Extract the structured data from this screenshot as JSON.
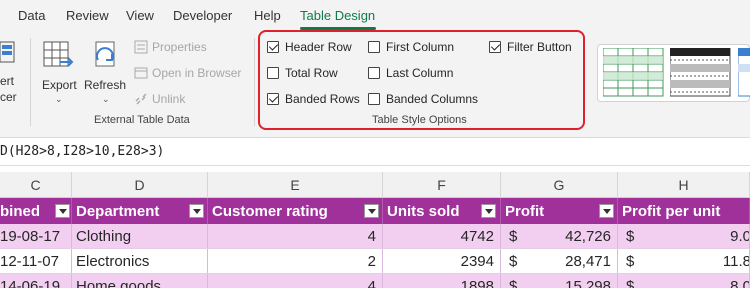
{
  "tabs": [
    "Data",
    "Review",
    "View",
    "Developer",
    "Help",
    "Table Design"
  ],
  "active_tab": "Table Design",
  "ribbon": {
    "tools": {
      "insert_slicer_line1": "ert",
      "insert_slicer_line2": "cer"
    },
    "external": {
      "export_label": "Export",
      "refresh_label": "Refresh",
      "properties_label": "Properties",
      "open_in_browser_label": "Open in Browser",
      "unlink_label": "Unlink",
      "group_label": "External Table Data"
    },
    "style_options": {
      "group_label": "Table Style Options",
      "options": [
        {
          "label": "Header Row",
          "checked": true
        },
        {
          "label": "Total Row",
          "checked": false
        },
        {
          "label": "Banded Rows",
          "checked": true
        },
        {
          "label": "First Column",
          "checked": false
        },
        {
          "label": "Last Column",
          "checked": false
        },
        {
          "label": "Banded Columns",
          "checked": false
        },
        {
          "label": "Filter Button",
          "checked": true
        }
      ]
    }
  },
  "formula": "D(H28>8,I28>10,E28>3)",
  "columns": [
    "C",
    "D",
    "E",
    "F",
    "G",
    "H"
  ],
  "table": {
    "headers": [
      "bined",
      "Department",
      "Customer rating",
      "Units sold",
      "Profit",
      "Profit per unit"
    ],
    "rows": [
      {
        "date": "19-08-17",
        "dept": "Clothing",
        "rating": "4",
        "units": "4742",
        "profit_sym": "$",
        "profit": "42,726",
        "ppu_sym": "$",
        "ppu": "9.0"
      },
      {
        "date": "12-11-07",
        "dept": "Electronics",
        "rating": "2",
        "units": "2394",
        "profit_sym": "$",
        "profit": "28,471",
        "ppu_sym": "$",
        "ppu": "11.8"
      },
      {
        "date": "14-06-19",
        "dept": "Home goods",
        "rating": "4",
        "units": "1898",
        "profit_sym": "$",
        "profit": "15,298",
        "ppu_sym": "$",
        "ppu": "8.0"
      }
    ]
  },
  "colors": {
    "header_bg": "#a0309a",
    "band_pink": "#f2cff0",
    "accent_green": "#0f7b4a",
    "highlight_red": "#e0202a"
  }
}
